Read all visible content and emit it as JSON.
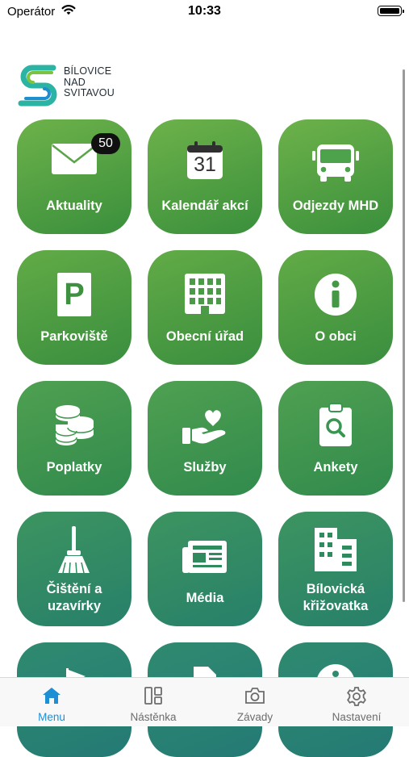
{
  "status_bar": {
    "carrier": "Operátor",
    "time": "10:33"
  },
  "logo": {
    "lines": [
      "BÍLOVICE",
      "NAD",
      "SVITAVOU"
    ]
  },
  "tiles": [
    {
      "label": "Aktuality",
      "icon": "envelope-icon",
      "badge": "50",
      "color_top": "#6db24a",
      "color_bottom": "#3a8f3c"
    },
    {
      "label": "Kalendář akcí",
      "icon": "calendar-icon",
      "calendar_day": "31",
      "color_top": "#6db24a",
      "color_bottom": "#3a8f3c"
    },
    {
      "label": "Odjezdy MHD",
      "icon": "bus-icon",
      "color_top": "#6db24a",
      "color_bottom": "#3a8f3c"
    },
    {
      "label": "Parkoviště",
      "icon": "parking-icon",
      "parking_letter": "P",
      "color_top": "#62ab46",
      "color_bottom": "#3a8e3f"
    },
    {
      "label": "Obecní úřad",
      "icon": "town-hall-icon",
      "color_top": "#62ab46",
      "color_bottom": "#3a8e3f"
    },
    {
      "label": "O obci",
      "icon": "info-icon",
      "color_top": "#62ab46",
      "color_bottom": "#3a8e3f"
    },
    {
      "label": "Poplatky",
      "icon": "coins-icon",
      "color_top": "#4fa050",
      "color_bottom": "#318a4d"
    },
    {
      "label": "Služby",
      "icon": "hand-heart-icon",
      "color_top": "#4fa050",
      "color_bottom": "#318a4d"
    },
    {
      "label": "Ankety",
      "icon": "clipboard-search-icon",
      "color_top": "#4fa050",
      "color_bottom": "#318a4d"
    },
    {
      "label": "Čištění a\nuzavírky",
      "icon": "broom-icon",
      "color_top": "#3d9460",
      "color_bottom": "#27806a"
    },
    {
      "label": "Média",
      "icon": "newspaper-icon",
      "color_top": "#3d9460",
      "color_bottom": "#27806a"
    },
    {
      "label": "Bílovická\nkřižovatka",
      "icon": "buildings-icon",
      "color_top": "#3d9460",
      "color_bottom": "#27806a"
    },
    {
      "label": "",
      "icon": "flag-icon",
      "color_top": "#2f8a70",
      "color_bottom": "#247a74"
    },
    {
      "label": "",
      "icon": "document-icon",
      "color_top": "#2f8a70",
      "color_bottom": "#247a74"
    },
    {
      "label": "",
      "icon": "info-icon",
      "color_top": "#2f8a70",
      "color_bottom": "#247a74"
    }
  ],
  "tabbar": {
    "active_color": "#1e8fd4",
    "items": [
      {
        "label": "Menu",
        "icon": "home-icon",
        "active": true
      },
      {
        "label": "Nástěnka",
        "icon": "board-icon",
        "active": false
      },
      {
        "label": "Závady",
        "icon": "camera-icon",
        "active": false
      },
      {
        "label": "Nastavení",
        "icon": "gear-icon",
        "active": false
      }
    ]
  }
}
